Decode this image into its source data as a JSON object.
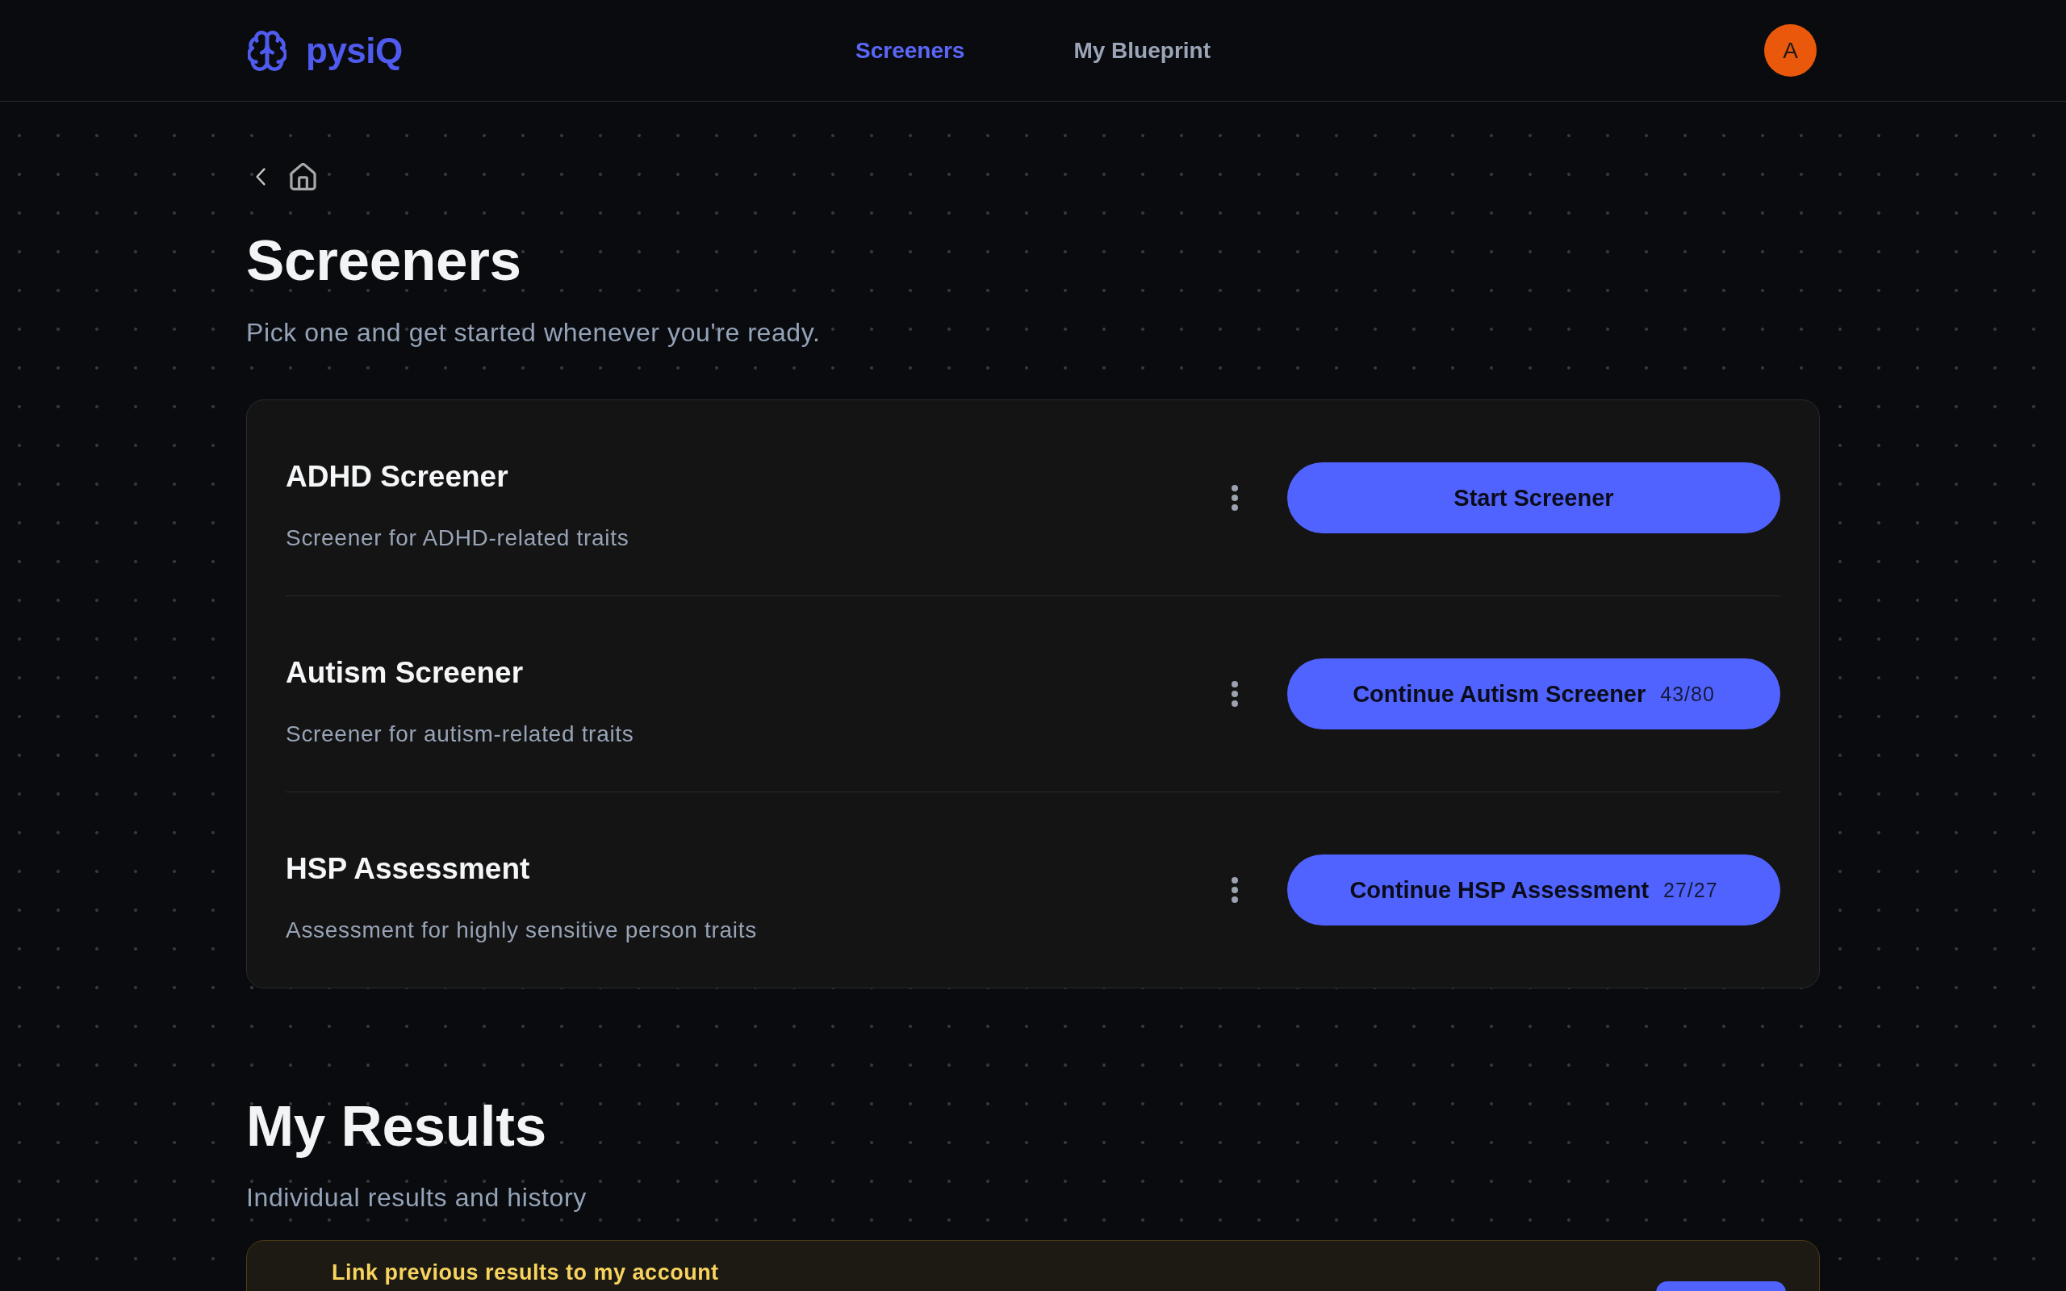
{
  "header": {
    "logo_text": "pysiQ",
    "nav": [
      {
        "label": "Screeners",
        "selected": true
      },
      {
        "label": "My Blueprint",
        "selected": false
      }
    ],
    "avatar": {
      "initial": "A"
    }
  },
  "screeners_section": {
    "title": "Screeners",
    "subtitle": "Pick one and get started whenever you're ready.",
    "screeners": [
      {
        "name": "ADHD Screener",
        "description": "Screener for ADHD-related traits",
        "action": "Start Screener"
      },
      {
        "name": "Autism Screener",
        "description": "Screener for autism-related traits",
        "action": "Continue Autism Screener",
        "progress": "43/80"
      },
      {
        "name": "HSP Assessment",
        "description": "Assessment for highly sensitive person traits",
        "action": "Continue HSP Assessment",
        "progress": "27/27"
      }
    ]
  },
  "results_section": {
    "title": "My Results",
    "subtitle": "Individual results and history",
    "link_banner": {
      "text": "Link previous results to my account"
    }
  }
}
